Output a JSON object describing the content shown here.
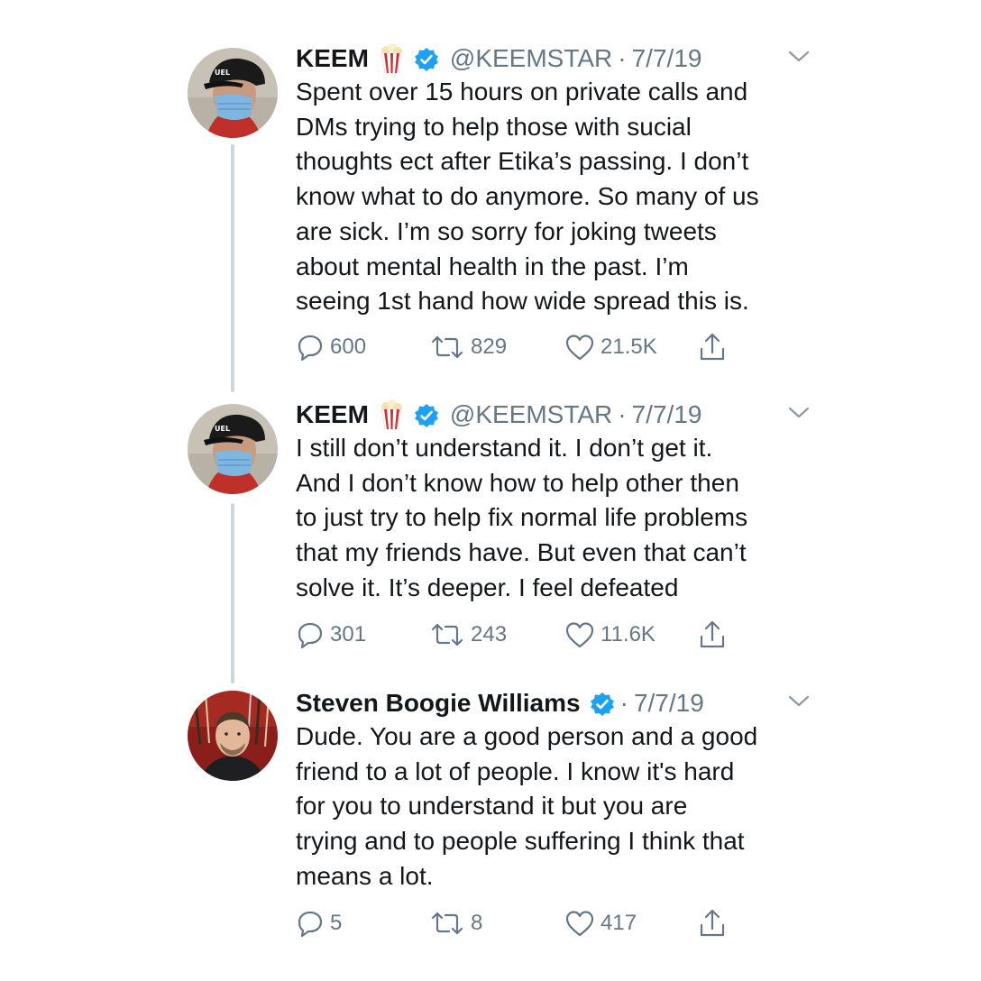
{
  "tweets": [
    {
      "name": "KEEM",
      "name_emoji": "popcorn-icon",
      "verified": true,
      "handle": "@KEEMSTAR",
      "separator": "·",
      "date": "7/7/19",
      "text": "Spent over 15 hours on private calls and\nDMs trying to help those with sucial\nthoughts ect after Etika’s passing. I don’t\nknow what to do anymore. So many of us\nare sick. I’m so sorry for joking tweets\nabout mental health in the past. I’m\nseeing 1st hand how wide spread this is.",
      "replies": "600",
      "retweets": "829",
      "likes": "21.5K"
    },
    {
      "name": "KEEM",
      "name_emoji": "popcorn-icon",
      "verified": true,
      "handle": "@KEEMSTAR",
      "separator": "·",
      "date": "7/7/19",
      "text": "I still don’t understand it. I don’t get it.\nAnd I don’t know how to help other then\nto just try to help fix normal life problems\nthat my friends have. But even that can’t\nsolve it. It’s deeper. I feel defeated",
      "replies": "301",
      "retweets": "243",
      "likes": "11.6K"
    },
    {
      "name": "Steven Boogie Williams",
      "verified": true,
      "separator": "·",
      "date": "7/7/19",
      "text": "Dude.  You are a good person and a good\nfriend to a lot of people.  I know it's hard\nfor you to understand it but you are\ntrying and to people suffering I think that\nmeans a lot.",
      "replies": "5",
      "retweets": "8",
      "likes": "417"
    }
  ],
  "colors": {
    "verified_blue": "#1da1f2",
    "secondary_text": "#657786",
    "thread_line": "#cdd6dd"
  }
}
